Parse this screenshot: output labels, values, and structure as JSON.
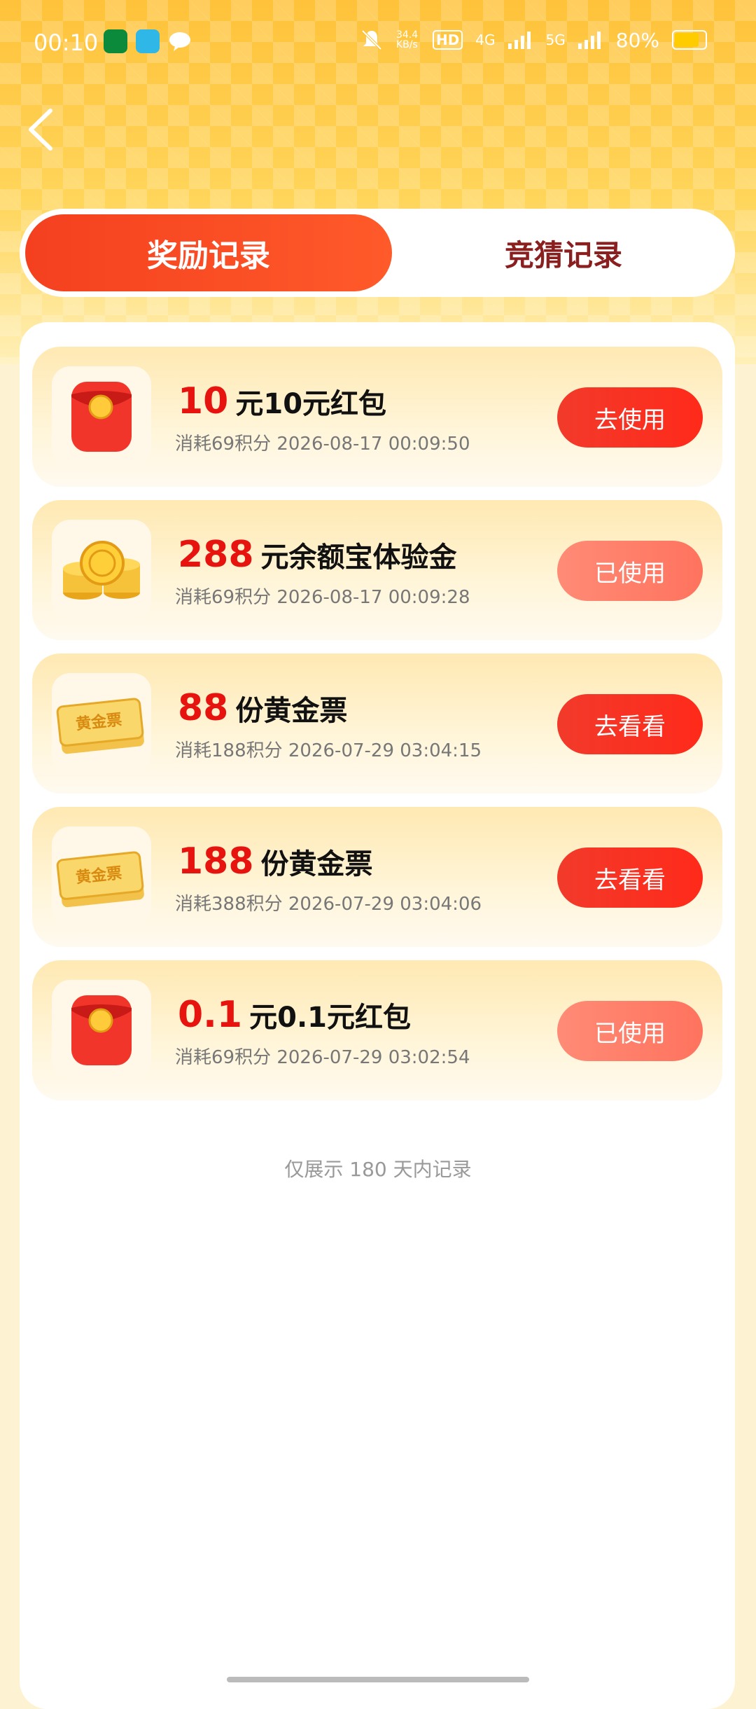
{
  "status_bar": {
    "time": "00:10",
    "network_speed": "34.4 KB/s",
    "hd": "HD",
    "net_4g": "4G",
    "net_5g": "5G",
    "battery": "80%"
  },
  "tabs": [
    {
      "label": "奖励记录",
      "active": true
    },
    {
      "label": "竞猜记录",
      "active": false
    }
  ],
  "records": [
    {
      "amount": "10",
      "title": "元10元红包",
      "subtitle": "消耗69积分 2026-08-17 00:09:50",
      "action": "去使用",
      "icon": "red-envelope-icon",
      "state": "active"
    },
    {
      "amount": "288",
      "title": "元余额宝体验金",
      "subtitle": "消耗69积分 2026-08-17 00:09:28",
      "action": "已使用",
      "icon": "gold-coins-icon",
      "state": "used"
    },
    {
      "amount": "88",
      "title": "份黄金票",
      "subtitle": "消耗188积分 2026-07-29 03:04:15",
      "action": "去看看",
      "icon": "gold-ticket-icon",
      "state": "active"
    },
    {
      "amount": "188",
      "title": "份黄金票",
      "subtitle": "消耗388积分 2026-07-29 03:04:06",
      "action": "去看看",
      "icon": "gold-ticket-icon",
      "state": "active"
    },
    {
      "amount": "0.1",
      "title": "元0.1元红包",
      "subtitle": "消耗69积分 2026-07-29 03:02:54",
      "action": "已使用",
      "icon": "red-envelope-icon",
      "state": "used"
    }
  ],
  "ticket_label": "黄金票",
  "footer": "仅展示 180 天内记录",
  "colors": {
    "accent": "#f4401f",
    "amount": "#e6130e",
    "button_active": "#f23a2b",
    "button_used": "#ff8b76"
  }
}
